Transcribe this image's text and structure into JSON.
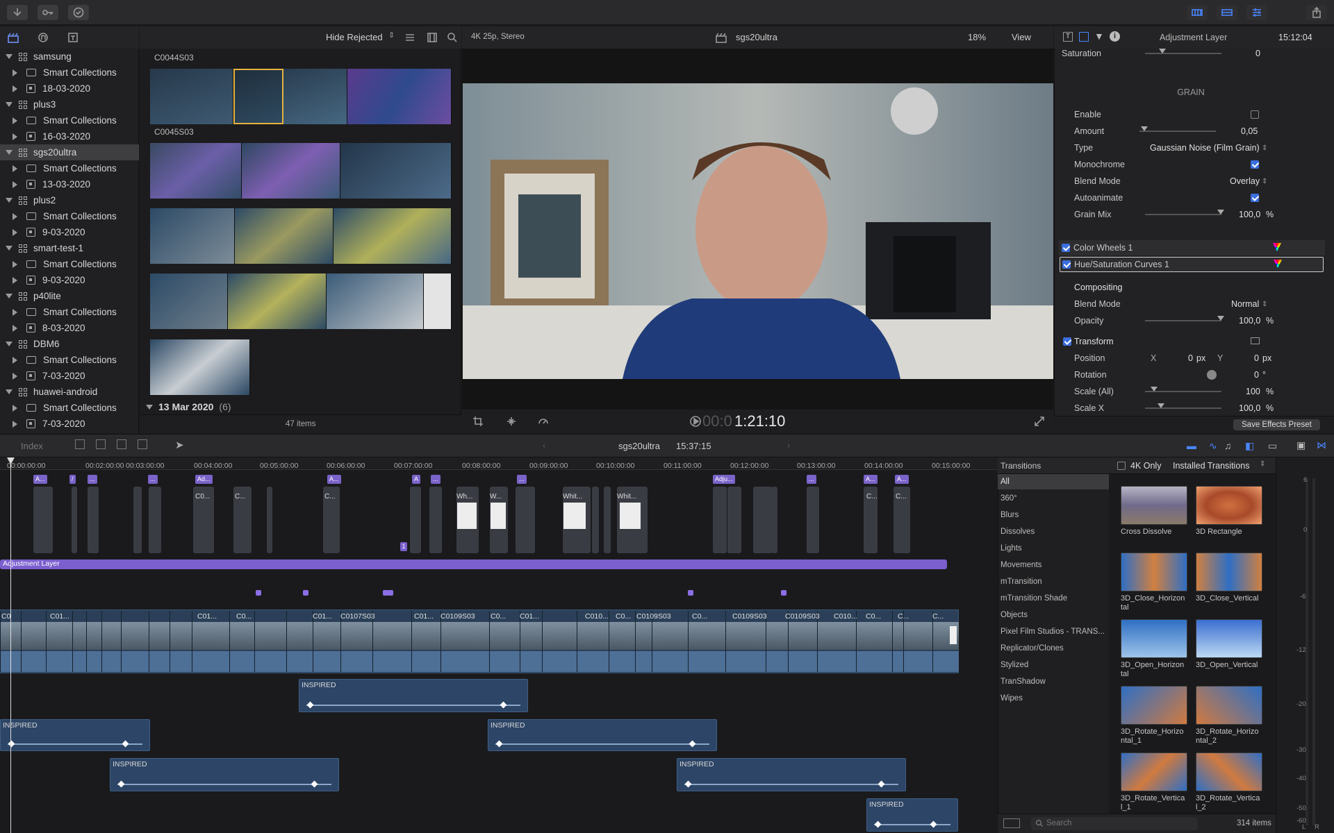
{
  "toolbar": {
    "import_icon": "download-icon",
    "keywords_icon": "key-icon",
    "background_tasks_icon": "checkmark-circle-icon"
  },
  "library": {
    "items": [
      {
        "label": "samsung",
        "kind": "library",
        "expanded": true
      },
      {
        "label": "Smart Collections",
        "kind": "folder"
      },
      {
        "label": "18-03-2020",
        "kind": "event"
      },
      {
        "label": "plus3",
        "kind": "library",
        "expanded": true
      },
      {
        "label": "Smart Collections",
        "kind": "folder"
      },
      {
        "label": "16-03-2020",
        "kind": "event"
      },
      {
        "label": "sgs20ultra",
        "kind": "library",
        "expanded": true,
        "selected": true
      },
      {
        "label": "Smart Collections",
        "kind": "folder"
      },
      {
        "label": "13-03-2020",
        "kind": "event"
      },
      {
        "label": "plus2",
        "kind": "library",
        "expanded": true
      },
      {
        "label": "Smart Collections",
        "kind": "folder"
      },
      {
        "label": "9-03-2020",
        "kind": "event"
      },
      {
        "label": "smart-test-1",
        "kind": "library",
        "expanded": true
      },
      {
        "label": "Smart Collections",
        "kind": "folder"
      },
      {
        "label": "9-03-2020",
        "kind": "event"
      },
      {
        "label": "p40lite",
        "kind": "library",
        "expanded": true
      },
      {
        "label": "Smart Collections",
        "kind": "folder"
      },
      {
        "label": "8-03-2020",
        "kind": "event"
      },
      {
        "label": "DBM6",
        "kind": "library",
        "expanded": true
      },
      {
        "label": "Smart Collections",
        "kind": "folder"
      },
      {
        "label": "7-03-2020",
        "kind": "event"
      },
      {
        "label": "huawei-android",
        "kind": "library",
        "expanded": true
      },
      {
        "label": "Smart Collections",
        "kind": "folder"
      },
      {
        "label": "7-03-2020",
        "kind": "event"
      }
    ]
  },
  "browser": {
    "filter": "Hide Rejected",
    "clip1": "C0044S03",
    "clip2": "C0045S03",
    "date_group": "13 Mar 2020",
    "date_count": "(6)",
    "item_count": "47 items"
  },
  "viewer": {
    "format": "4K 25p, Stereo",
    "project": "sgs20ultra",
    "zoom": "18%",
    "view_menu": "View",
    "timecode_dim": "00:0",
    "timecode": "1:21:10"
  },
  "inspector": {
    "title": "Adjustment Layer",
    "duration": "15:12:04",
    "saturation_label": "Saturation",
    "saturation_value": "0",
    "grain_header": "GRAIN",
    "enable_label": "Enable",
    "amount_label": "Amount",
    "amount_value": "0,05",
    "type_label": "Type",
    "type_value": "Gaussian Noise (Film Grain)",
    "monochrome_label": "Monochrome",
    "blend_label": "Blend Mode",
    "blend_value": "Overlay",
    "autoanimate_label": "Autoanimate",
    "grainmix_label": "Grain Mix",
    "grainmix_value": "100,0",
    "percent": "%",
    "colorwheels_label": "Color Wheels 1",
    "huesat_label": "Hue/Saturation Curves 1",
    "compositing_label": "Compositing",
    "comp_blend_label": "Blend Mode",
    "comp_blend_value": "Normal",
    "opacity_label": "Opacity",
    "opacity_value": "100,0",
    "transform_label": "Transform",
    "position_label": "Position",
    "pos_x_label": "X",
    "pos_x_value": "0",
    "pos_y_label": "Y",
    "pos_y_value": "0",
    "px": "px",
    "rotation_label": "Rotation",
    "rotation_value": "0",
    "degree": "°",
    "scale_all_label": "Scale (All)",
    "scale_all_value": "100",
    "scale_x_label": "Scale X",
    "scale_x_value": "100,0",
    "save_preset": "Save Effects Preset"
  },
  "timeline": {
    "index_label": "Index",
    "project": "sgs20ultra",
    "duration": "15:37:15",
    "ruler": [
      "00:00:00:00",
      "00:02:00:00",
      "00:03:00:00",
      "00:04:00:00",
      "00:05:00:00",
      "00:06:00:00",
      "00:07:00:00",
      "00:08:00:00",
      "00:09:00:00",
      "00:10:00:00",
      "00:11:00:00",
      "00:12:00:00",
      "00:13:00:00",
      "00:14:00:00",
      "00:15:00:00"
    ],
    "adjustment_layer": "Adjustment Layer",
    "audio_label": "INSPIRED",
    "marker_number": "1",
    "conn_tags": [
      "A...",
      "A...",
      "Ad...",
      "A...",
      "A",
      "Adju...",
      "A...",
      "A..."
    ],
    "conn_labels": [
      "C0...",
      "C...",
      "C...",
      "Wh...",
      "W...",
      "Whit...",
      "Whit...",
      "C...",
      "C..."
    ],
    "primary_labels": [
      "C0",
      "C01...",
      "C01...",
      "C0...",
      "C01...",
      "C0107S03",
      "C01...",
      "C0109S03",
      "C0...",
      "C01...",
      "C010...",
      "C0...",
      "C0109S03",
      "C0...",
      "C0109S03",
      "C0109S03",
      "C010...",
      "C0...",
      "C...",
      "C..."
    ]
  },
  "transitions": {
    "title": "Transitions",
    "filter_4k": "4K Only",
    "installed": "Installed Transitions",
    "categories": [
      "All",
      "360°",
      "Blurs",
      "Dissolves",
      "Lights",
      "Movements",
      "mTransition",
      "mTransition Shade",
      "Objects",
      "Pixel Film Studios - TRANS...",
      "Replicator/Clones",
      "Stylized",
      "TranShadow",
      "Wipes"
    ],
    "items": [
      {
        "name": "Cross Dissolve"
      },
      {
        "name": "3D Rectangle"
      },
      {
        "name": "3D_Close_Horizon tal"
      },
      {
        "name": "3D_Close_Vertical"
      },
      {
        "name": "3D_Open_Horizon tal"
      },
      {
        "name": "3D_Open_Vertical"
      },
      {
        "name": "3D_Rotate_Horizo ntal_1"
      },
      {
        "name": "3D_Rotate_Horizo ntal_2"
      },
      {
        "name": "3D_Rotate_Vertica l_1"
      },
      {
        "name": "3D_Rotate_Vertica l_2"
      }
    ],
    "search_placeholder": "Search",
    "count": "314 items"
  },
  "meter": {
    "scale": [
      "6",
      "0",
      "-6",
      "-12",
      "-20",
      "-30",
      "-40",
      "-50",
      "-60"
    ],
    "channels": [
      "L",
      "R"
    ]
  },
  "colors": {
    "accent": "#3b6fe0",
    "adjustment_layer": "#7b5fce",
    "storyline": "#2b4058"
  }
}
